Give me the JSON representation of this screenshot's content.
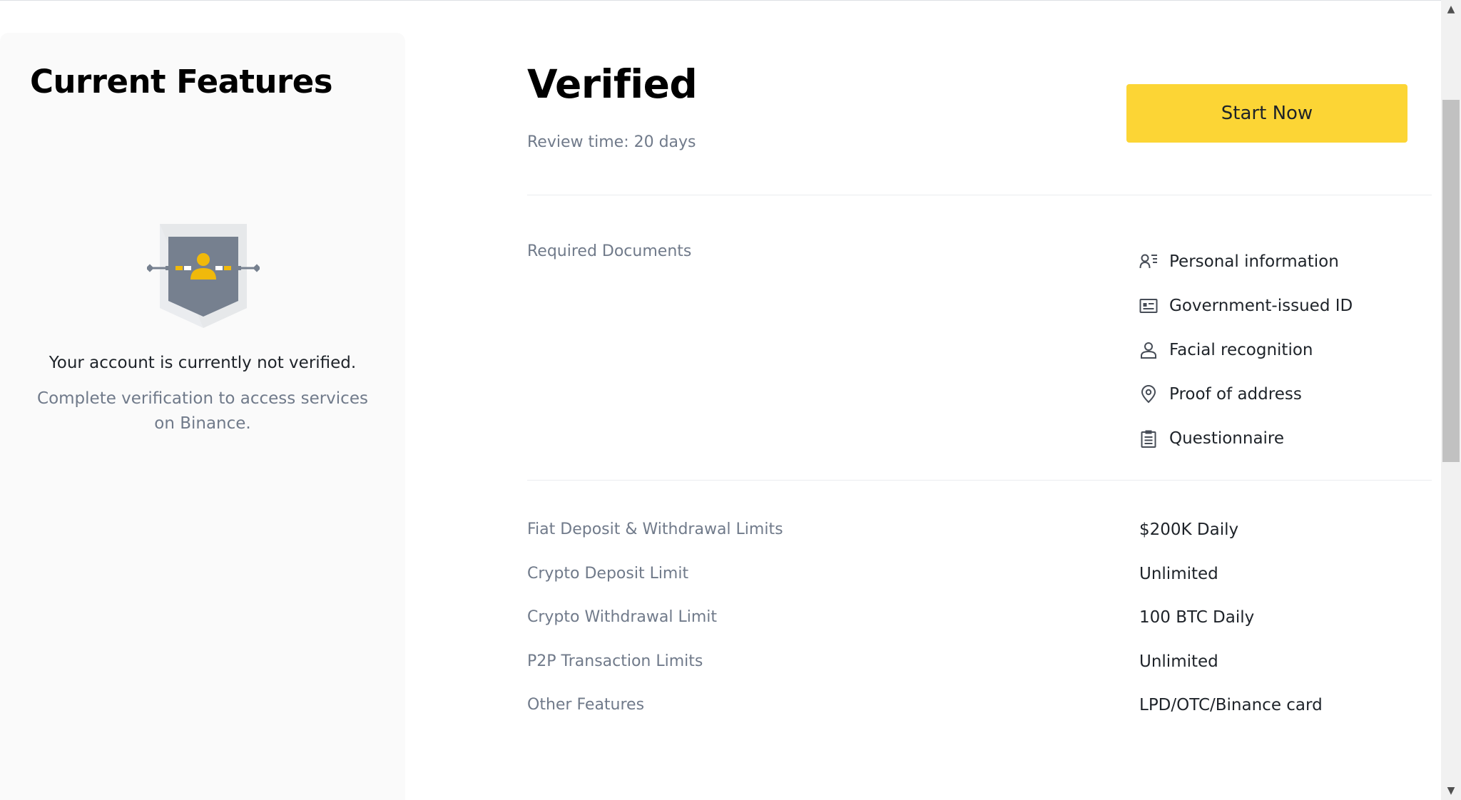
{
  "left_panel": {
    "title": "Current Features",
    "status_title": "Your account is currently not verified.",
    "status_desc": "Complete verification to access services on Binance."
  },
  "tier": {
    "title": "Verified",
    "review_time": "Review time: 20 days",
    "start_button": "Start Now"
  },
  "required_documents": {
    "label": "Required Documents",
    "items": [
      {
        "icon": "personal-info-icon",
        "label": "Personal information"
      },
      {
        "icon": "id-card-icon",
        "label": "Government-issued ID"
      },
      {
        "icon": "face-icon",
        "label": "Facial recognition"
      },
      {
        "icon": "location-pin-icon",
        "label": "Proof of address"
      },
      {
        "icon": "clipboard-icon",
        "label": "Questionnaire"
      }
    ]
  },
  "limits": [
    {
      "label": "Fiat Deposit & Withdrawal Limits",
      "value": "$200K Daily"
    },
    {
      "label": "Crypto Deposit Limit",
      "value": "Unlimited"
    },
    {
      "label": "Crypto Withdrawal Limit",
      "value": "100 BTC Daily"
    },
    {
      "label": "P2P Transaction Limits",
      "value": "Unlimited"
    },
    {
      "label": "Other Features",
      "value": "LPD/OTC/Binance card"
    }
  ],
  "colors": {
    "accent": "#FCD535",
    "muted_text": "#707A8A",
    "primary_text": "#1E2329",
    "panel_bg": "#FAFAFA"
  }
}
